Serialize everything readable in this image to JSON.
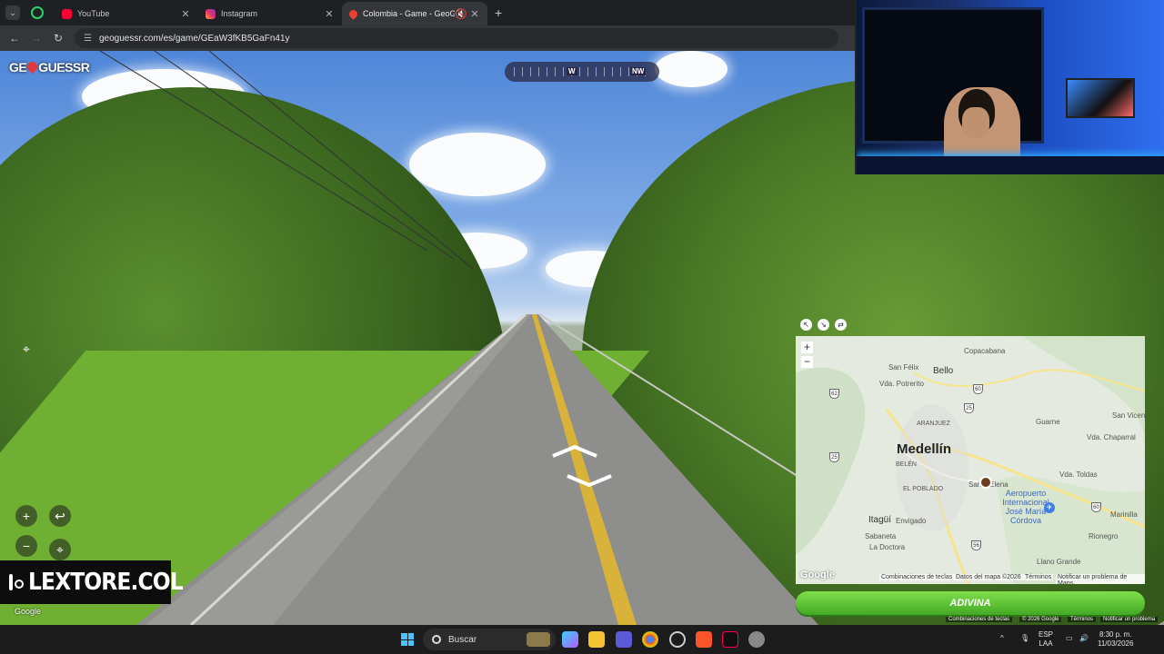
{
  "browser": {
    "tabs": [
      {
        "title": "YouTube",
        "active": false
      },
      {
        "title": "Instagram",
        "active": false
      },
      {
        "title": "Colombia - Game - GeoGuessr",
        "active": true
      }
    ],
    "url": "geoguessr.com/es/game/GEaW3fKB5GaFn41y"
  },
  "game": {
    "logo_left": "GE",
    "logo_right": "GUESSR",
    "compass": {
      "w": "W",
      "nw": "NW"
    }
  },
  "watermark": {
    "handle": "LEXTORE.COL"
  },
  "streetview": {
    "google": "Google"
  },
  "map": {
    "places": {
      "copacabana": "Copacabana",
      "bello": "Bello",
      "san_felix": "San Félix",
      "vda_potrerito": "Vda. Potrerito",
      "aranjuez": "ARANJUEZ",
      "medellin": "Medellín",
      "belen": "BELÉN",
      "el_poblado": "EL POBLADO",
      "santa_elena": "Santa Elena",
      "airport": "Aeropuerto Internacional José María Córdova",
      "itagui": "Itagüí",
      "envigado": "Envigado",
      "sabaneta": "Sabaneta",
      "la_doctora": "La Doctora",
      "guarne": "Guarne",
      "san_vicente": "San Vicen",
      "vda_chaparral": "Vda. Chaparral",
      "vda_toldas": "Vda. Toldas",
      "marinilla": "Marinilla",
      "rionegro": "Rionegro",
      "llano_grande": "Llano Grande"
    },
    "routes": {
      "r62": "62",
      "r60": "60",
      "r25a": "25",
      "r25b": "25",
      "r56": "56",
      "r60b": "60"
    },
    "google": "Google",
    "footer": {
      "shortcuts": "Combinaciones de teclas",
      "data": "Datos del mapa ©2026",
      "terms": "Términos",
      "report": "Notificar un problema de Maps"
    }
  },
  "guess_button": "ADIVINA",
  "sv_footer": {
    "shortcuts": "Combinaciones de teclas",
    "copyright": "© 2026 Google",
    "terms": "Términos",
    "report": "Notificar un problema"
  },
  "taskbar": {
    "search_placeholder": "Buscar",
    "lang": "ESP",
    "layout": "LAA",
    "time": "8:30 p. m.",
    "date": "11/03/2026"
  }
}
